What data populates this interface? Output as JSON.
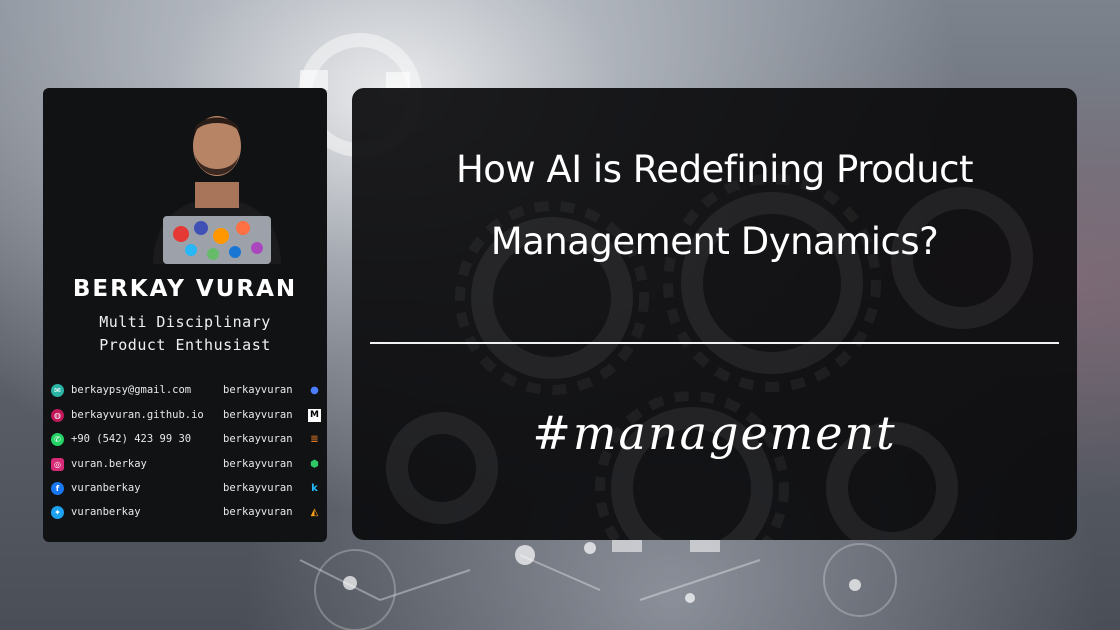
{
  "profile": {
    "name": "BERKAY VURAN",
    "role_line1": "Multi Disciplinary",
    "role_line2": "Product Enthusiast",
    "contacts": [
      {
        "icon": "email-icon",
        "color": "#2bb3a6",
        "text": "berkaypsy@gmail.com"
      },
      {
        "icon": "globe-icon",
        "color": "#c2185b",
        "text": "berkayvuran.github.io"
      },
      {
        "icon": "whatsapp-icon",
        "color": "#25d366",
        "text": "+90 (542) 423 99 30"
      },
      {
        "icon": "instagram-icon",
        "color": "#d62976",
        "text": "vuran.berkay"
      },
      {
        "icon": "facebook-icon",
        "color": "#1877f2",
        "text": "vuranberkay"
      },
      {
        "icon": "twitter-icon",
        "color": "#1da1f2",
        "text": "vuranberkay"
      }
    ],
    "handles": [
      {
        "icon": "github-icon",
        "color": "#4a7dff",
        "text": "berkayvuran"
      },
      {
        "icon": "medium-icon",
        "color": "#ffffff",
        "text": "berkayvuran"
      },
      {
        "icon": "stackoverflow-icon",
        "color": "#f48024",
        "text": "berkayvuran"
      },
      {
        "icon": "hackerrank-icon",
        "color": "#2ec866",
        "text": "berkayvuran"
      },
      {
        "icon": "kaggle-icon",
        "color": "#20beff",
        "text": "berkayvuran"
      },
      {
        "icon": "leetcode-icon",
        "color": "#ffa116",
        "text": "berkayvuran"
      }
    ]
  },
  "headline": {
    "line1": "How AI is Redefining Product",
    "line2": "Management Dynamics?"
  },
  "hashtag": "#management",
  "colors": {
    "card_bg": "#111214",
    "title_card_bg": "#0a0a0c",
    "text": "#ffffff"
  }
}
